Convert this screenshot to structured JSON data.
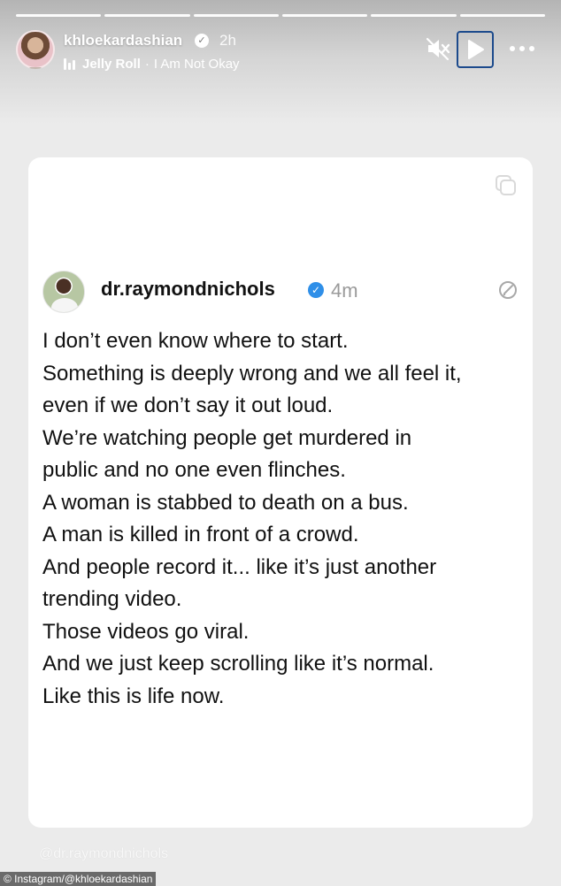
{
  "story": {
    "progress_segments": 6,
    "username": "khloekardashian",
    "time_ago": "2h",
    "music": {
      "artist": "Jelly Roll",
      "separator": "·",
      "title": "I Am Not Okay"
    },
    "icons": {
      "mute": "speaker-muted-icon",
      "play": "play-icon",
      "more": "more-options-icon"
    }
  },
  "post": {
    "username": "dr.raymondnichols",
    "verified_mark": "✓",
    "time_ago": "4m",
    "lines": [
      "I don’t even know where to start.",
      "Something is deeply wrong and we all feel it,",
      "even if we don’t say it out loud.",
      "We’re watching people get murdered in",
      "public and no one even flinches.",
      "A woman is stabbed to death on a bus.",
      "A man is killed in front of a crowd.",
      "And people record it... like it’s just another",
      "trending video.",
      "Those videos go viral.",
      "And we just keep scrolling like it’s normal.",
      "Like this is life now."
    ]
  },
  "watermark": "@dr.raymondnichols",
  "credit": "© Instagram/@khloekardashian",
  "colors": {
    "background": "#ebebeb",
    "card": "#ffffff",
    "verified_blue": "#2f8fe8",
    "play_outline": "#1c4a8c"
  }
}
